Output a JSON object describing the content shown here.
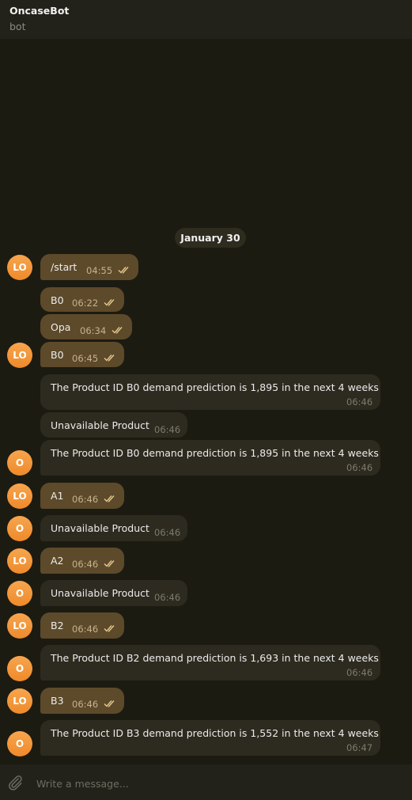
{
  "header": {
    "title": "OncaseBot",
    "status": "bot"
  },
  "date_separator": "January 30",
  "avatars": {
    "user": "LO",
    "bot": "O"
  },
  "messages": [
    {
      "text": "/start",
      "time": "04:55"
    },
    {
      "text": "B0",
      "time": "06:22"
    },
    {
      "text": "Opa",
      "time": "06:34"
    },
    {
      "text": "B0",
      "time": "06:45"
    },
    {
      "text": "The Product ID B0 demand prediction is 1,895 in the next 4 weeks",
      "time": "06:46"
    },
    {
      "text": "Unavailable Product",
      "time": "06:46"
    },
    {
      "text": "The Product ID B0 demand prediction is 1,895 in the next 4 weeks",
      "time": "06:46"
    },
    {
      "text": "A1",
      "time": "06:46"
    },
    {
      "text": "Unavailable Product",
      "time": "06:46"
    },
    {
      "text": "A2",
      "time": "06:46"
    },
    {
      "text": "Unavailable Product",
      "time": "06:46"
    },
    {
      "text": "B2",
      "time": "06:46"
    },
    {
      "text": "The Product ID B2 demand prediction is 1,693 in the next 4 weeks",
      "time": "06:46"
    },
    {
      "text": "B3",
      "time": "06:46"
    },
    {
      "text": "The Product ID B3 demand prediction is 1,552 in the next 4 weeks",
      "time": "06:47"
    }
  ],
  "composer": {
    "placeholder": "Write a message..."
  },
  "icons": {
    "attach": "paperclip-icon",
    "read_receipt": "double-check-icon"
  },
  "colors": {
    "background": "#1c1b12",
    "outgoing_bubble": "#5d4a2b",
    "incoming_bubble": "#2d2a1f",
    "avatar": "#f39c3f",
    "read_check": "#e6c98e"
  }
}
